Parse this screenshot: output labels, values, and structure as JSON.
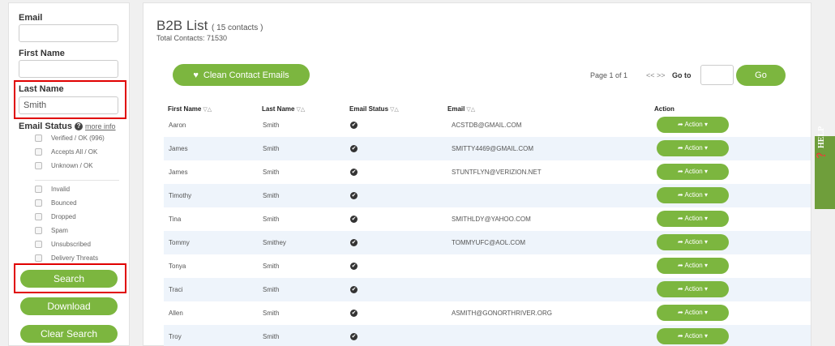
{
  "sidebar": {
    "email_label": "Email",
    "email_value": "",
    "first_name_label": "First Name",
    "first_name_value": "",
    "last_name_label": "Last Name",
    "last_name_value": "Smith",
    "email_status_label": "Email Status",
    "help_glyph": "?",
    "more_info": "more info",
    "statuses": [
      "Verified / OK (996)",
      "Accepts All / OK",
      "Unknown / OK",
      "Invalid",
      "Bounced",
      "Dropped",
      "Spam",
      "Unsubscribed",
      "Delivery Threats"
    ],
    "search_label": "Search",
    "download_label": "Download",
    "clear_label": "Clear Search"
  },
  "main": {
    "title": "B2B List",
    "title_count": "( 15 contacts )",
    "total": "Total Contacts: 71530",
    "clean_label": "Clean Contact Emails",
    "page_info": "Page 1 of 1",
    "pager_arrows": "<< >>",
    "goto_label": "Go to",
    "go_label": "Go",
    "columns": {
      "first_name": "First Name",
      "last_name": "Last Name",
      "email_status": "Email Status",
      "email": "Email",
      "action": "Action",
      "sort_glyph": "▽△"
    },
    "action_label": "Action",
    "rows": [
      {
        "first": "Aaron",
        "last": "Smith",
        "email": "ACSTDB@GMAIL.COM"
      },
      {
        "first": "James",
        "last": "Smith",
        "email": "SMITTY4469@GMAIL.COM"
      },
      {
        "first": "James",
        "last": "Smith",
        "email": "STUNTFLYN@VERIZION.NET"
      },
      {
        "first": "Timothy",
        "last": "Smith",
        "email": ""
      },
      {
        "first": "Tina",
        "last": "Smith",
        "email": "SMITHLDY@YAHOO.COM"
      },
      {
        "first": "Tommy",
        "last": "Smithey",
        "email": "TOMMYUFC@AOL.COM"
      },
      {
        "first": "Tonya",
        "last": "Smith",
        "email": ""
      },
      {
        "first": "Traci",
        "last": "Smith",
        "email": ""
      },
      {
        "first": "Allen",
        "last": "Smith",
        "email": "ASMITH@GONORTHRIVER.ORG"
      },
      {
        "first": "Troy",
        "last": "Smith",
        "email": ""
      }
    ]
  },
  "help_tab": {
    "label": "HELP"
  },
  "colors": {
    "accent": "#7cb63f",
    "highlight": "#e00000",
    "row_alt": "#eef4fb"
  }
}
